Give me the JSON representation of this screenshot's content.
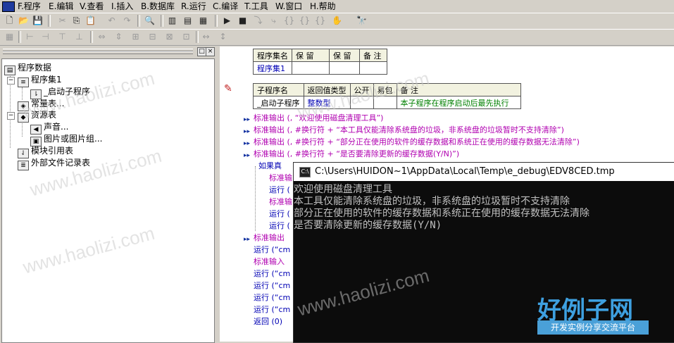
{
  "menu": {
    "items": [
      "F.程序",
      "E.编辑",
      "V.查看",
      "I.插入",
      "B.数据库",
      "R.运行",
      "C.编译",
      "T.工具",
      "W.窗口",
      "H.帮助"
    ]
  },
  "tree": {
    "root": "程序数据",
    "program_set": "程序集1",
    "startup_sub": "_启动子程序",
    "constants": "常量表...",
    "resources": "资源表",
    "sound": "声音...",
    "images": "图片或图片组...",
    "module_ref": "模块引用表",
    "external_files": "外部文件记录表"
  },
  "table1": {
    "headers": [
      "程序集名",
      "保 留",
      "保 留",
      "备 注"
    ],
    "row": [
      "程序集1",
      "",
      "",
      ""
    ]
  },
  "table2": {
    "headers": [
      "子程序名",
      "返回值类型",
      "公开",
      "易包",
      "备 注"
    ],
    "row": [
      "_启动子程序",
      "整数型",
      "",
      "",
      "本子程序在程序启动后最先执行"
    ]
  },
  "code": {
    "lines": [
      "标准输出 (, “欢迎使用磁盘清理工具”)",
      "标准输出 (, #换行符 + “本工具仅能清除系统盘的垃圾，非系统盘的垃圾暂时不支持清除”)",
      "标准输出 (, #换行符 + “部分正在使用的软件的缓存数据和系统正在使用的缓存数据无法清除”)",
      "标准输出 (, #换行符 + “是否要清除更新的缓存数据(Y/N)”)",
      "如果真",
      "标准输",
      "运行 (",
      "标准输",
      "运行 (",
      "运行 (",
      "标准输出",
      "运行 (“cm",
      "标准输入",
      "运行 (“cm",
      "运行 (“cm",
      "运行 (“cm",
      "运行 (“cm",
      "返回 (0)"
    ]
  },
  "console": {
    "title": "C:\\Users\\HUIDON~1\\AppData\\Local\\Temp\\e_debug\\EDV8CED.tmp",
    "lines": [
      "欢迎使用磁盘清理工具",
      "本工具仅能清除系统盘的垃圾，非系统盘的垃圾暂时不支持清除",
      "部分正在使用的软件的缓存数据和系统正在使用的缓存数据无法清除",
      "是否要清除更新的缓存数据(Y/N)"
    ]
  },
  "watermark": {
    "text": "www.haolizi.com",
    "logo": "好例子网",
    "logo_sub": "开发实例分享交流平台"
  },
  "colors": {
    "console_bg": "#0c0c0c",
    "keyword": "#0000b4",
    "string": "#b000b0",
    "remark_green": "#008000"
  }
}
